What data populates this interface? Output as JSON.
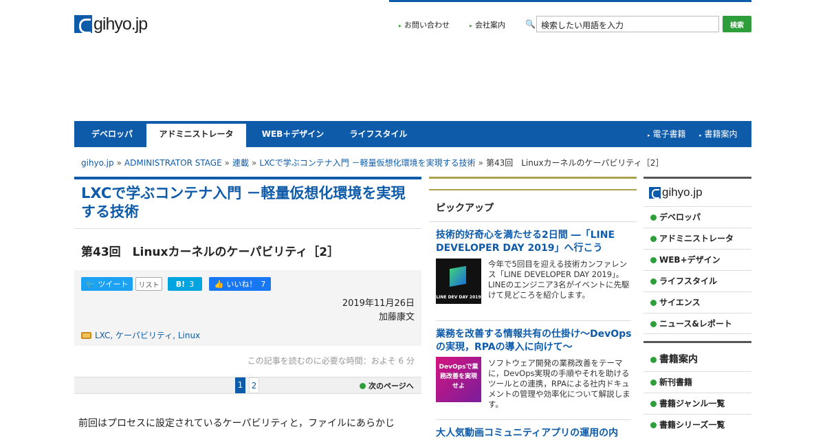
{
  "header": {
    "logo_text": "gihyo.jp",
    "links": [
      "お問い合わせ",
      "会社案内"
    ],
    "search_value": "検索したい用語を入力",
    "search_button": "検索"
  },
  "nav": {
    "tabs": [
      "デベロッパ",
      "アドミニストレータ",
      "WEB＋デザイン",
      "ライフスタイル"
    ],
    "active_tab": "アドミニストレータ",
    "sub_links": [
      "電子書籍",
      "書籍案内"
    ]
  },
  "breadcrumb": [
    "gihyo.jp",
    "ADMINISTRATOR STAGE",
    "連載",
    "LXCで学ぶコンテナ入門 －軽量仮想化環境を実現する技術",
    "第43回　Linuxカーネルのケーパビリティ［2］"
  ],
  "article": {
    "series_title": "LXCで学ぶコンテナ入門 －軽量仮想化環境を実現する技術",
    "title": "第43回　Linuxカーネルのケーパビリティ［2］",
    "share": {
      "tweet": "ツイート",
      "list": "リスト",
      "hatena": "B!",
      "hatena_count": "3",
      "like": "いいね！",
      "like_count": "7"
    },
    "date": "2019年11月26日",
    "author": "加藤康文",
    "tags": "LXC, ケーパビリティ, Linux",
    "read_time": "この記事を読むのに必要な時間：およそ 6 分",
    "pages": [
      "1",
      "2"
    ],
    "next_page": "次のページへ",
    "body_start": "前回はプロセスに設定されているケーパビリティと，ファイルにあらかじ"
  },
  "pickup": {
    "heading": "ピックアップ",
    "items": [
      {
        "title": "技術的好奇心を満たせる2日間 ―「LINE DEVELOPER DAY 2019」へ行こう",
        "text": "今年で5回目を迎える技術カンファレンス「LINE DEVELOPER DAY 2019」。LINEのエンジニア3名がイベントに先駆けて見どころを紹介します。",
        "thumb_caption": "LINE DEV DAY 2019"
      },
      {
        "title": "業務を改善する情報共有の仕掛け～DevOpsの実現，RPAの導入に向けて～",
        "text": "ソフトウェア開発の業務改善をテーマに，DevOps実現の手順やそれを助けるツールとの連携，RPAによる社内ドキュメントの管理や効率化について解説します。",
        "thumb_caption": "DevOpsで業務改善を実現せよ"
      },
      {
        "title": "大人気動画コミュニティアプリの運用の内",
        "text": "",
        "thumb_caption": ""
      }
    ]
  },
  "sidebar": {
    "logo_text": "gihyo.jp",
    "categories": [
      "デベロッパ",
      "アドミニストレータ",
      "WEB+デザイン",
      "ライフスタイル",
      "サイエンス",
      "ニュース&レポート"
    ],
    "books_heading": "書籍案内",
    "books_links": [
      "新刊書籍",
      "書籍ジャンル一覧",
      "書籍シリーズ一覧"
    ]
  },
  "colors": {
    "brand": "#0e5ba9",
    "accent_green": "#2e9e3a",
    "pickup_rule": "#a9a14b"
  }
}
